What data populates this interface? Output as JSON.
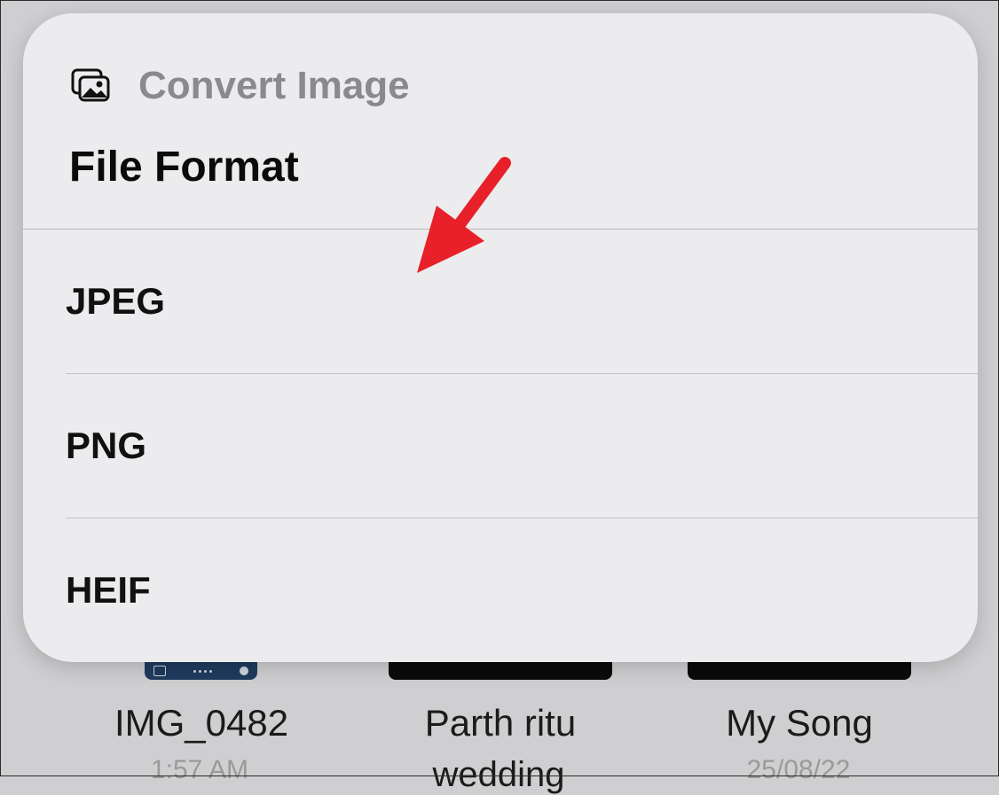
{
  "sheet": {
    "app_title": "Convert Image",
    "section_title": "File Format",
    "options": [
      {
        "label": "JPEG"
      },
      {
        "label": "PNG"
      },
      {
        "label": "HEIF"
      }
    ]
  },
  "background_shortcuts": [
    {
      "name": "IMG_0482",
      "subtitle": "1:57 AM"
    },
    {
      "name": "Parth ritu",
      "subtitle": "wedding"
    },
    {
      "name": "My Song",
      "subtitle": "25/08/22"
    }
  ],
  "icons": {
    "app_icon": "photos-stack-icon",
    "annotation": "red-arrow-icon"
  },
  "colors": {
    "sheet_bg": "#ececee",
    "title_gray": "#8a8a8c",
    "arrow_red": "#e8202a"
  }
}
